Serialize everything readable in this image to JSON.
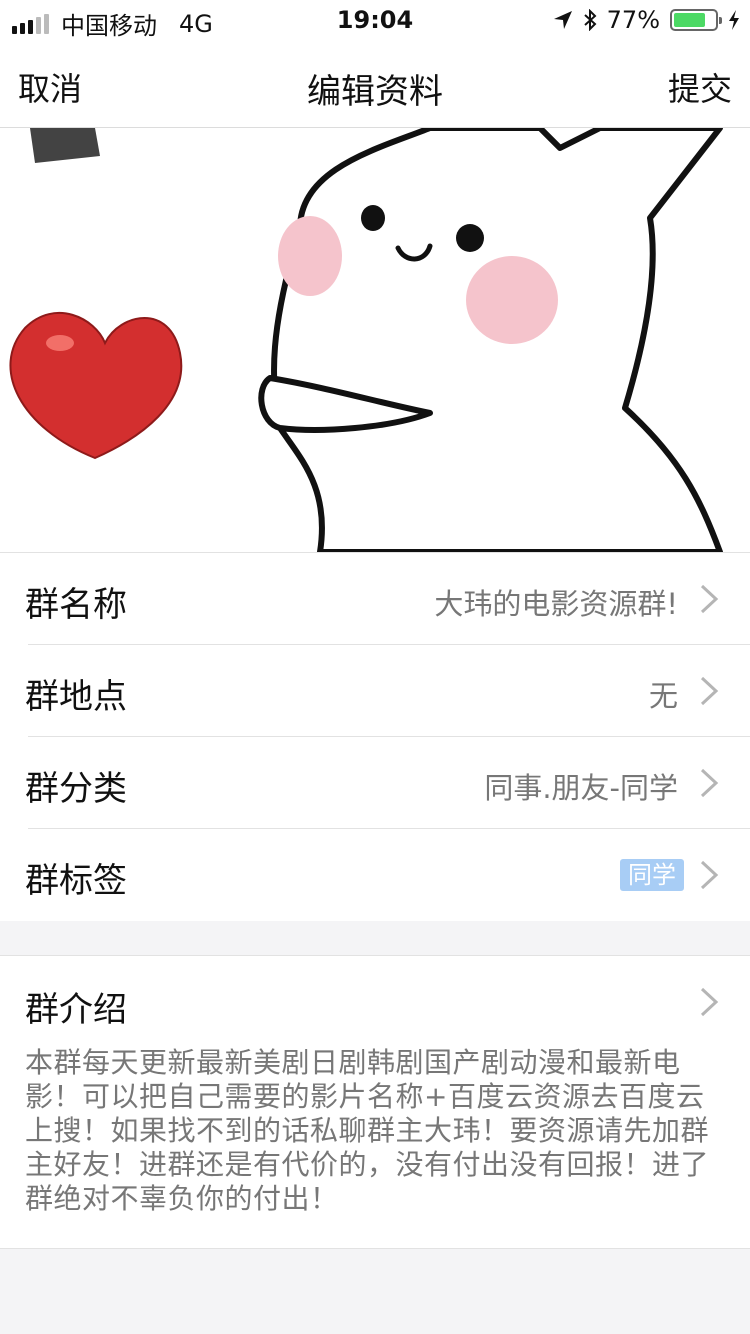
{
  "status_bar": {
    "carrier": "中国移动",
    "network": "4G",
    "time": "19:04",
    "battery_percent": "77%",
    "battery_level": 0.77,
    "battery_color": "#4cd964"
  },
  "nav": {
    "cancel_label": "取消",
    "title": "编辑资料",
    "submit_label": "提交"
  },
  "info_rows": [
    {
      "label": "群名称",
      "value": "大玮的电影资源群!"
    },
    {
      "label": "群地点",
      "value": "无"
    },
    {
      "label": "群分类",
      "value": "同事.朋友-同学"
    },
    {
      "label": "群标签",
      "tag": "同学"
    }
  ],
  "intro": {
    "label": "群介绍",
    "text": "本群每天更新最新美剧日剧韩剧国产剧动漫和最新电影！可以把自己需要的影片名称+百度云资源去百度云上搜！如果找不到的话私聊群主大玮！要资源请先加群主好友！进群还是有代价的，没有付出没有回报！进了群绝对不辜负你的付出！"
  },
  "colors": {
    "tag_bg": "#a8cdf5",
    "heart": "#d32f2f",
    "blush": "#f5c4cc"
  },
  "icons": [
    "location-arrow-icon",
    "bluetooth-icon",
    "charging-icon",
    "chevron-right-icon"
  ]
}
